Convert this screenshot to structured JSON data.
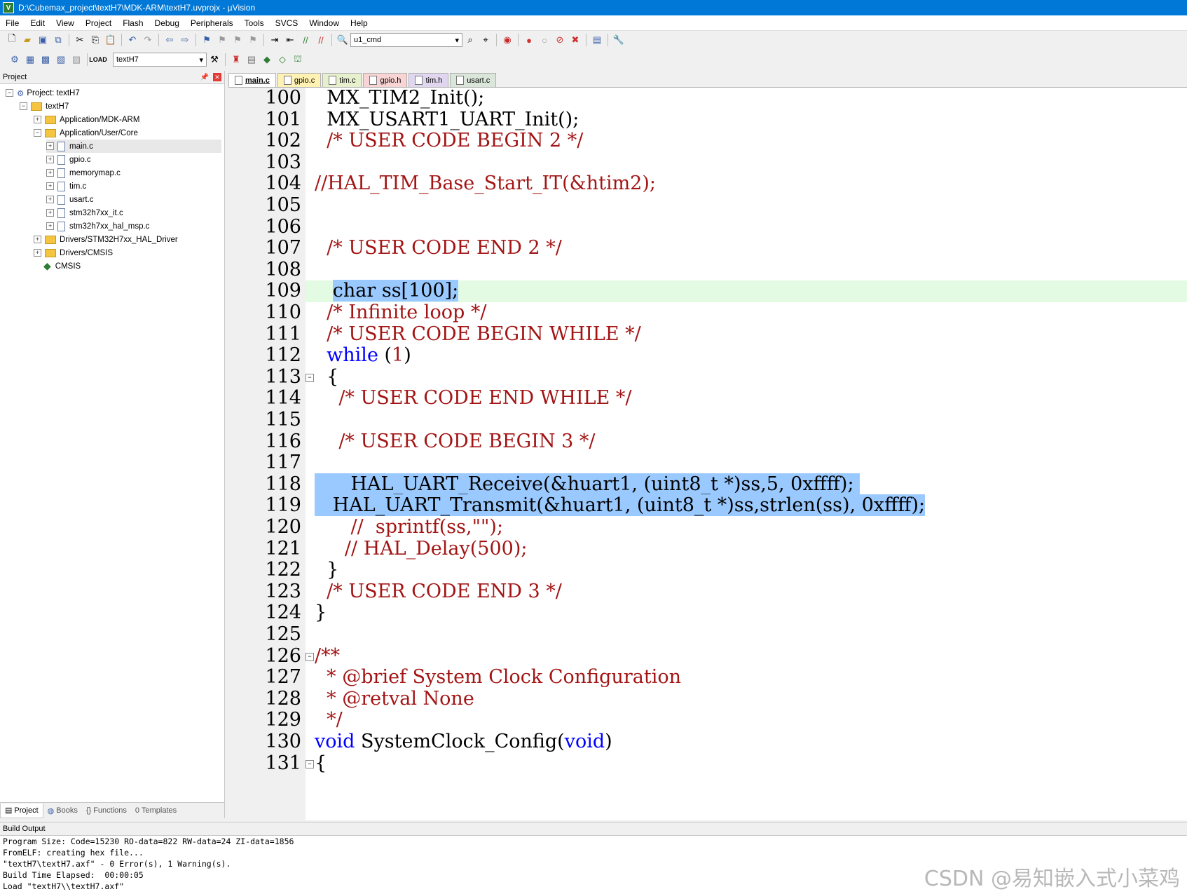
{
  "window": {
    "title": "D:\\Cubemax_project\\textH7\\MDK-ARM\\textH7.uvprojx - µVision"
  },
  "menu": [
    "File",
    "Edit",
    "View",
    "Project",
    "Flash",
    "Debug",
    "Peripherals",
    "Tools",
    "SVCS",
    "Window",
    "Help"
  ],
  "toolbar": {
    "find_combo": "u1_cmd",
    "target_combo": "textH7"
  },
  "project_panel": {
    "title": "Project",
    "tree": [
      {
        "label": "Project: textH7",
        "kind": "root"
      },
      {
        "label": "textH7",
        "kind": "folder"
      },
      {
        "label": "Application/MDK-ARM",
        "kind": "folder"
      },
      {
        "label": "Application/User/Core",
        "kind": "folder"
      },
      {
        "label": "main.c",
        "kind": "file"
      },
      {
        "label": "gpio.c",
        "kind": "file"
      },
      {
        "label": "memorymap.c",
        "kind": "file"
      },
      {
        "label": "tim.c",
        "kind": "file"
      },
      {
        "label": "usart.c",
        "kind": "file"
      },
      {
        "label": "stm32h7xx_it.c",
        "kind": "file"
      },
      {
        "label": "stm32h7xx_hal_msp.c",
        "kind": "file"
      },
      {
        "label": "Drivers/STM32H7xx_HAL_Driver",
        "kind": "folder"
      },
      {
        "label": "Drivers/CMSIS",
        "kind": "folder"
      },
      {
        "label": "CMSIS",
        "kind": "component"
      }
    ],
    "bottom_tabs": [
      "Project",
      "Books",
      "Functions",
      "Templates"
    ]
  },
  "editor": {
    "tabs": [
      {
        "label": "main.c",
        "color": "#ffffff"
      },
      {
        "label": "gpio.c",
        "color": "#fff2b3"
      },
      {
        "label": "tim.c",
        "color": "#e6f0cc"
      },
      {
        "label": "gpio.h",
        "color": "#f8d4d4"
      },
      {
        "label": "tim.h",
        "color": "#e0d6f0"
      },
      {
        "label": "usart.c",
        "color": "#d9e6d9"
      }
    ],
    "lines": [
      {
        "n": "100",
        "segs": [
          [
            "  MX_TIM2_Init();",
            "#000000"
          ]
        ]
      },
      {
        "n": "101",
        "segs": [
          [
            "  MX_USART1_UART_Init();",
            "#000000"
          ]
        ]
      },
      {
        "n": "102",
        "segs": [
          [
            "  /* USER CODE BEGIN 2 */",
            "#a31515"
          ]
        ]
      },
      {
        "n": "103",
        "segs": []
      },
      {
        "n": "104",
        "segs": [
          [
            "//HAL_TIM_Base_Start_IT(&htim2);",
            "#a31515"
          ]
        ]
      },
      {
        "n": "105",
        "segs": []
      },
      {
        "n": "106",
        "segs": []
      },
      {
        "n": "107",
        "segs": [
          [
            "  /* USER CODE END 2 */",
            "#a31515"
          ]
        ]
      },
      {
        "n": "108",
        "segs": []
      },
      {
        "n": "109",
        "segs": [
          [
            "   ",
            "#000000"
          ],
          [
            "char ss[100];",
            "#000000",
            "sel"
          ]
        ],
        "current": true
      },
      {
        "n": "110",
        "segs": [
          [
            "  /* Infinite loop */",
            "#a31515"
          ]
        ]
      },
      {
        "n": "111",
        "segs": [
          [
            "  /* USER CODE BEGIN WHILE */",
            "#a31515"
          ]
        ]
      },
      {
        "n": "112",
        "segs": [
          [
            "  ",
            "#000000"
          ],
          [
            "while",
            "#0000ff"
          ],
          [
            " (",
            "#000000"
          ],
          [
            "1",
            "#a31515"
          ],
          [
            ")",
            "#000000"
          ]
        ]
      },
      {
        "n": "113",
        "segs": [
          [
            "  {",
            "#000000"
          ]
        ],
        "fold": "−"
      },
      {
        "n": "114",
        "segs": [
          [
            "    /* USER CODE END WHILE */",
            "#a31515"
          ]
        ]
      },
      {
        "n": "115",
        "segs": []
      },
      {
        "n": "116",
        "segs": [
          [
            "    /* USER CODE BEGIN 3 */",
            "#a31515"
          ]
        ]
      },
      {
        "n": "117",
        "segs": []
      },
      {
        "n": "118",
        "segs": [
          [
            "      HAL_UART_Receive(&huart1, (uint8_t *)ss,5, 0xffff); ",
            "#000000",
            "sel"
          ]
        ]
      },
      {
        "n": "119",
        "segs": [
          [
            "   HAL_UART_Transmit(&huart1, (uint8_t *)ss,strlen(ss), 0xffff);",
            "#000000",
            "sel"
          ]
        ]
      },
      {
        "n": "120",
        "segs": [
          [
            "      //  sprintf(ss,\"\");",
            "#a31515"
          ]
        ]
      },
      {
        "n": "121",
        "segs": [
          [
            "     // HAL_Delay(500);",
            "#a31515"
          ]
        ]
      },
      {
        "n": "122",
        "segs": [
          [
            "  }",
            "#000000"
          ]
        ]
      },
      {
        "n": "123",
        "segs": [
          [
            "  /* USER CODE END 3 */",
            "#a31515"
          ]
        ]
      },
      {
        "n": "124",
        "segs": [
          [
            "}",
            "#000000"
          ]
        ]
      },
      {
        "n": "125",
        "segs": []
      },
      {
        "n": "126",
        "segs": [
          [
            "/**",
            "#a31515"
          ]
        ],
        "fold": "−"
      },
      {
        "n": "127",
        "segs": [
          [
            "  * @brief System Clock Configuration",
            "#a31515"
          ]
        ]
      },
      {
        "n": "128",
        "segs": [
          [
            "  * @retval None",
            "#a31515"
          ]
        ]
      },
      {
        "n": "129",
        "segs": [
          [
            "  */",
            "#a31515"
          ]
        ]
      },
      {
        "n": "130",
        "segs": [
          [
            "void",
            "#0000ff"
          ],
          [
            " SystemClock_Config(",
            "#000000"
          ],
          [
            "void",
            "#0000ff"
          ],
          [
            ")",
            "#000000"
          ]
        ]
      },
      {
        "n": "131",
        "segs": [
          [
            "{",
            "#000000"
          ]
        ],
        "fold": "−"
      }
    ]
  },
  "build_output": {
    "title": "Build Output",
    "lines": [
      "Program Size: Code=15230 RO-data=822 RW-data=24 ZI-data=1856",
      "FromELF: creating hex file...",
      "\"textH7\\textH7.axf\" - 0 Error(s), 1 Warning(s).",
      "Build Time Elapsed:  00:00:05",
      "Load \"textH7\\\\textH7.axf\""
    ]
  },
  "watermark": "CSDN @易知嵌入式小菜鸡",
  "colors": {
    "selection": "#99c9ff",
    "current_line": "#e2fbe2",
    "title_bar": "#0078d7",
    "keyword": "#0000ff",
    "comment": "#a31515"
  }
}
